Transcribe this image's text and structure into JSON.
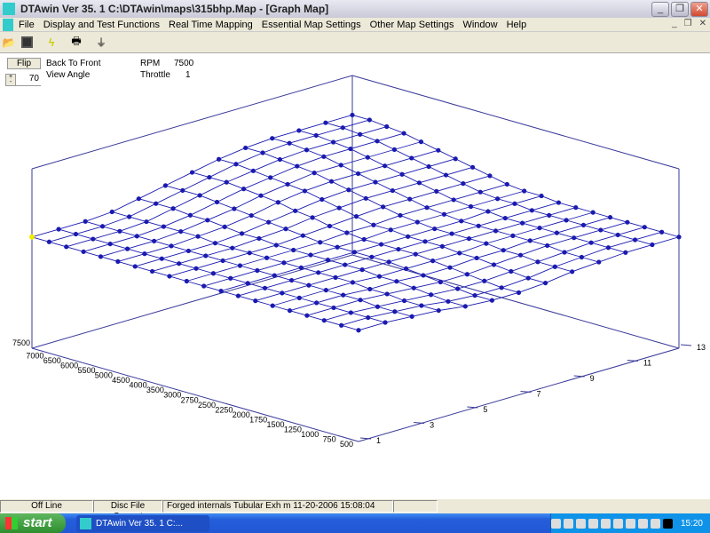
{
  "window": {
    "title": "DTAwin Ver  35. 1  C:\\DTAwin\\maps\\315bhp.Map - [Graph Map]",
    "min": "_",
    "restore": "❐",
    "close": "✕"
  },
  "menu": [
    "File",
    "Display and Test Functions",
    "Real Time Mapping",
    "Essential Map Settings",
    "Other Map Settings",
    "Window",
    "Help"
  ],
  "mdi": {
    "min": "_",
    "restore": "❐",
    "close": "✕"
  },
  "toolbar": [
    "open",
    "save",
    "lightning",
    "print",
    "tool"
  ],
  "controls": {
    "flip": "Flip",
    "back_to_front": "Back To Front",
    "view_angle_label": "View Angle",
    "view_angle": "70",
    "rpm_label": "RPM",
    "rpm_value": "7500",
    "throttle_label": "Throttle",
    "throttle_value": "1"
  },
  "chart_data": {
    "type": "surface3d",
    "rpm_axis": [
      500,
      750,
      1000,
      1250,
      1500,
      1750,
      2000,
      2250,
      2500,
      2750,
      3000,
      3500,
      4000,
      4500,
      5000,
      5500,
      6000,
      6500,
      7000,
      7500
    ],
    "throttle_axis": [
      1,
      2,
      3,
      4,
      5,
      6,
      7,
      8,
      9,
      10,
      11,
      12,
      13
    ],
    "throttle_tick_labels": [
      "1",
      "3",
      "5",
      "7",
      "9",
      "11",
      "13"
    ],
    "z": [
      [
        62,
        62,
        61,
        60,
        58,
        57,
        57,
        58,
        60,
        61,
        62,
        62,
        62
      ],
      [
        62,
        62,
        61,
        60,
        58,
        57,
        57,
        58,
        60,
        61,
        62,
        62,
        62
      ],
      [
        62,
        62,
        61,
        60,
        59,
        58,
        58,
        59,
        60,
        61,
        62,
        62,
        62
      ],
      [
        62,
        62,
        62,
        61,
        60,
        59,
        59,
        60,
        61,
        62,
        62,
        62,
        62
      ],
      [
        62,
        62,
        62,
        61,
        61,
        60,
        60,
        61,
        61,
        62,
        62,
        62,
        62
      ],
      [
        62,
        62,
        62,
        62,
        61,
        61,
        61,
        61,
        62,
        62,
        62,
        62,
        62
      ],
      [
        62,
        62,
        62,
        62,
        62,
        62,
        62,
        62,
        62,
        62,
        62,
        62,
        62
      ],
      [
        62,
        62,
        62,
        62,
        62,
        62,
        62,
        62,
        62,
        62,
        62,
        62,
        62
      ],
      [
        62,
        62,
        62,
        62,
        62,
        62,
        62,
        62,
        62,
        62,
        63,
        63,
        63
      ],
      [
        62,
        62,
        62,
        62,
        62,
        62,
        62,
        63,
        63,
        63,
        63,
        63,
        63
      ],
      [
        62,
        62,
        62,
        62,
        62,
        62,
        63,
        63,
        64,
        64,
        64,
        64,
        64
      ],
      [
        62,
        62,
        62,
        62,
        62,
        63,
        64,
        65,
        66,
        66,
        66,
        66,
        66
      ],
      [
        62,
        62,
        62,
        62,
        63,
        64,
        66,
        67,
        68,
        68,
        68,
        68,
        68
      ],
      [
        62,
        62,
        62,
        62,
        63,
        65,
        67,
        69,
        70,
        70,
        70,
        70,
        70
      ],
      [
        62,
        62,
        62,
        63,
        64,
        66,
        69,
        71,
        72,
        72,
        72,
        72,
        72
      ],
      [
        62,
        62,
        62,
        63,
        65,
        67,
        70,
        72,
        74,
        74,
        74,
        74,
        74
      ],
      [
        62,
        62,
        62,
        63,
        65,
        68,
        71,
        73,
        75,
        76,
        76,
        76,
        76
      ],
      [
        62,
        62,
        62,
        63,
        66,
        69,
        72,
        74,
        76,
        77,
        77,
        77,
        77
      ],
      [
        62,
        62,
        62,
        63,
        66,
        69,
        72,
        75,
        77,
        78,
        78,
        78,
        78
      ],
      [
        62,
        62,
        62,
        63,
        66,
        69,
        72,
        75,
        77,
        78,
        78,
        78,
        78
      ]
    ],
    "zlim": [
      0,
      100
    ],
    "series_color": "#1a1ab0"
  },
  "status": [
    "Off Line",
    "Disc File Current",
    "Forged internals Tubular Exh m 11-20-2006 15:08:04",
    ""
  ],
  "taskbar": {
    "start": "start",
    "task": "DTAwin Ver  35. 1  C:...",
    "clock": "15:20"
  }
}
